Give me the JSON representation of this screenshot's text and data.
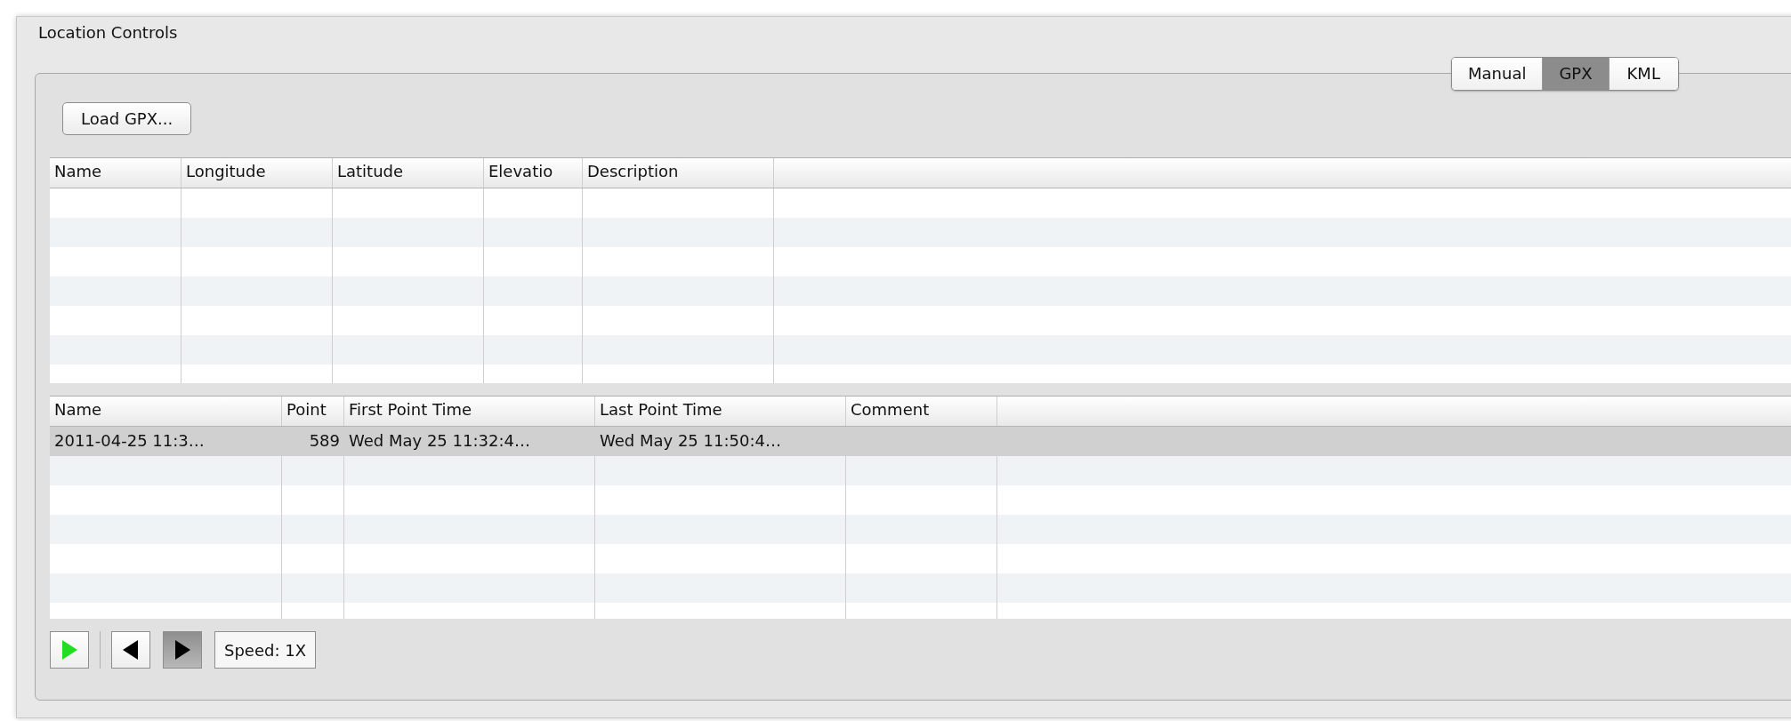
{
  "window": {
    "title": "Location Controls"
  },
  "tabs": [
    {
      "label": "Manual",
      "selected": false
    },
    {
      "label": "GPX",
      "selected": true
    },
    {
      "label": "KML",
      "selected": false
    }
  ],
  "load_button": {
    "label": "Load GPX..."
  },
  "waypoints_table": {
    "columns": [
      "Name",
      "Longitude",
      "Latitude",
      "Elevatio",
      "Description"
    ]
  },
  "tracks_table": {
    "columns": [
      "Name",
      "Point",
      "First Point Time",
      "Last Point Time",
      "Comment"
    ],
    "rows": [
      {
        "selected": true,
        "cells": [
          "2011-04-25 11:3…",
          "589",
          "Wed May 25 11:32:4…",
          "Wed May 25 11:50:4…",
          ""
        ]
      }
    ]
  },
  "playback": [
    {
      "kind": "play",
      "pressed": false
    },
    {
      "kind": "back",
      "pressed": false
    },
    {
      "kind": "forward",
      "pressed": true
    }
  ],
  "speed": {
    "label": "Speed: 1X"
  }
}
